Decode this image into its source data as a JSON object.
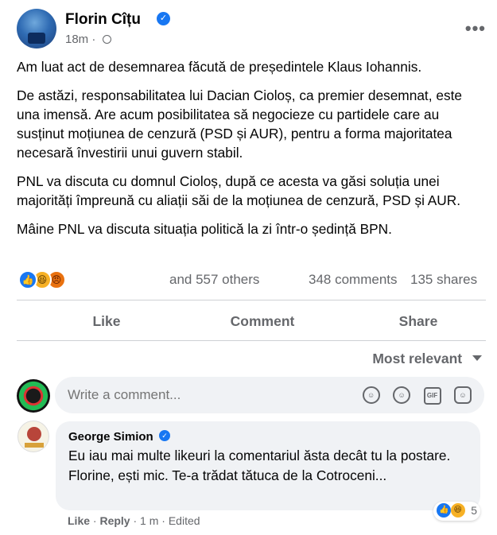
{
  "post": {
    "author": "Florin Cîțu",
    "time": "18m",
    "time_sep": "·",
    "paragraphs": [
      "Am luat act de desemnarea făcută de președintele Klaus Iohannis.",
      "De astăzi, responsabilitatea lui Dacian Cioloș, ca premier desemnat, este una imensă. Are acum posibilitatea să negocieze cu partidele care au susținut moțiunea de cenzură (PSD și AUR), pentru a forma majoritatea necesară învestirii unui guvern stabil.",
      "PNL va discuta cu domnul Cioloș, după ce acesta va găsi soluția unei majorități împreună cu aliații săi de la moțiunea de cenzură, PSD și AUR.",
      "Mâine PNL va discuta situația politică la zi într-o ședință BPN."
    ]
  },
  "stats": {
    "reactions": "and 557 others",
    "comments": "348 comments",
    "shares": "135 shares"
  },
  "actions": {
    "like": "Like",
    "comment": "Comment",
    "share": "Share"
  },
  "sort": {
    "label": "Most relevant"
  },
  "composer": {
    "placeholder": "Write a comment..."
  },
  "comment": {
    "author": "George Simion",
    "text": "Eu iau mai multe likeuri la comentariul ăsta decât tu la postare. Florine, ești mic. Te-a trădat tătuca de la Cotroceni...",
    "reaction_count": "5",
    "like": "Like",
    "dot": " · ",
    "reply": "Reply",
    "time": "1 m",
    "edited": "Edited"
  },
  "colors": {
    "accent": "#1877f2",
    "secondary_text": "#65676b",
    "bubble": "#f0f2f5"
  }
}
